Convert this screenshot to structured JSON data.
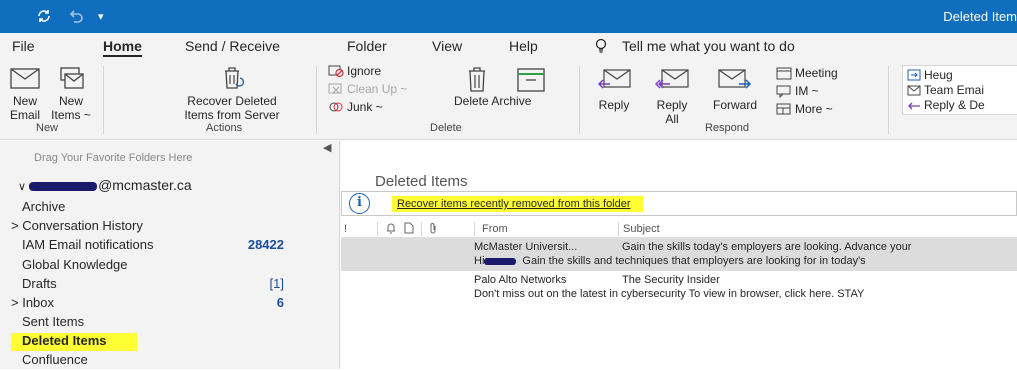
{
  "titlebar": {
    "title": "Deleted Item"
  },
  "menu": {
    "tabs": [
      "File",
      "Home",
      "Send / Receive",
      "Folder",
      "View",
      "Help"
    ],
    "tell_me": "Tell me what you want to do"
  },
  "ribbon": {
    "new_email": [
      "New",
      "Email"
    ],
    "new_items": [
      "New",
      "Items ~"
    ],
    "recover": [
      "Recover Deleted",
      "Items from Server"
    ],
    "ignore": "Ignore",
    "clean_up": "Clean Up ~",
    "junk": "Junk ~",
    "delete_archive": "Delete Archive",
    "reply": "Reply",
    "reply_all": [
      "Reply",
      "All"
    ],
    "forward": "Forward",
    "meeting": "Meeting",
    "im": "IM ~",
    "more": "More ~",
    "quick_steps": [
      "Heug",
      "Team Emai",
      "Reply & De"
    ],
    "groups": {
      "new": "New",
      "actions": "Actions",
      "delete": "Delete",
      "respond": "Respond"
    }
  },
  "sidebar": {
    "drag_hint": "Drag Your Favorite Folders Here",
    "account_suffix": "@mcmaster.ca",
    "folders": [
      {
        "label": "Archive",
        "count": ""
      },
      {
        "label": "> Conversation History",
        "count": ""
      },
      {
        "label": "IAM Email notifications",
        "count": "28422"
      },
      {
        "label": "Global Knowledge",
        "count": ""
      },
      {
        "label": "Drafts",
        "count": "[1]"
      },
      {
        "label": "> Inbox",
        "count": "6"
      },
      {
        "label": "Sent Items",
        "count": ""
      },
      {
        "label": "Deleted Items",
        "count": ""
      },
      {
        "label": "Confluence",
        "count": ""
      }
    ]
  },
  "main": {
    "folder_title": "Deleted Items",
    "recover_link": "Recover items recently removed from this folder",
    "columns": {
      "importance": "!",
      "from": "From",
      "subject": "Subject"
    },
    "messages": [
      {
        "from": "McMaster Universit...",
        "subject": "Gain the skills today's employers are looking. Advance your",
        "preview_prefix": "Hi",
        "preview": "Gain the skills and techniques that employers are looking for in today's"
      },
      {
        "from": "Palo Alto Networks",
        "subject": "The Security Insider",
        "preview": "Don't miss out on the latest in cybersecurity  To view in browser, click here.  STAY"
      }
    ]
  }
}
